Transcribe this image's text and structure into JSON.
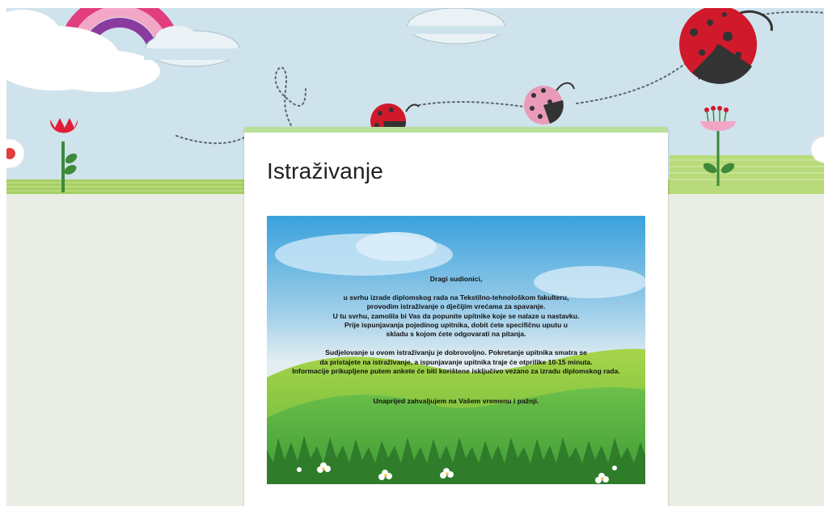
{
  "form": {
    "title": "Istraživanje"
  },
  "intro_image": {
    "greeting": "Dragi sudionici,",
    "paragraph1": [
      "u svrhu izrade diplomskog rada na Tekstilno-tehnološkom fakulteru,",
      "provodim istraživanje o dječijim vrećama za spavanje.",
      "U tu svrhu, zamolila bi Vas da popunite upitnike koje se nalaze u nastavku.",
      "Prije ispunjavanja pojedinog upitnika, dobit ćete specifičnu uputu u",
      "skladu s kojom ćete odgovarati na pitanja."
    ],
    "paragraph2": [
      "Sudjelovanje u ovom istraživanju je dobrovoljno. Pokretanje upitnika smatra se",
      "da pristajete na istraživanje, a ispunjavanje upitnika traje će otprilike 10-15 minuta.",
      "Informacije prikupljene putem ankete će biti korištene isključivo vezano za izradu diplomskog rada."
    ],
    "closing": "Unaprijed zahvaljujem na Vašem vremenu i pažnji."
  },
  "theme": {
    "accent": "#b9e19b",
    "sky": "#cfe3ec",
    "grass": "#a6cf62",
    "page_background": "#e9ede4",
    "ladybug_red": "#d0192b",
    "ladybug_pink": "#e89ab8"
  }
}
